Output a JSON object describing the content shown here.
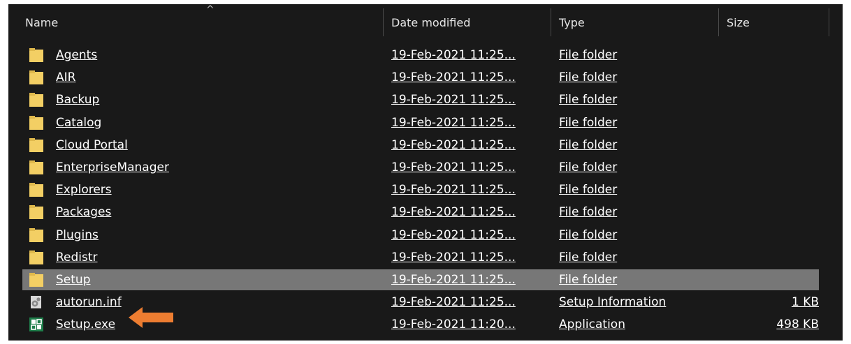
{
  "columns": {
    "name": "Name",
    "date": "Date modified",
    "type": "Type",
    "size": "Size"
  },
  "files": [
    {
      "name": "Agents",
      "date": "19-Feb-2021 11:25...",
      "type": "File folder",
      "size": "",
      "icon": "folder-icon"
    },
    {
      "name": "AIR",
      "date": "19-Feb-2021 11:25...",
      "type": "File folder",
      "size": "",
      "icon": "folder-icon"
    },
    {
      "name": "Backup",
      "date": "19-Feb-2021 11:25...",
      "type": "File folder",
      "size": "",
      "icon": "folder-icon"
    },
    {
      "name": "Catalog",
      "date": "19-Feb-2021 11:25...",
      "type": "File folder",
      "size": "",
      "icon": "folder-icon"
    },
    {
      "name": "Cloud Portal",
      "date": "19-Feb-2021 11:25...",
      "type": "File folder",
      "size": "",
      "icon": "folder-icon"
    },
    {
      "name": "EnterpriseManager",
      "date": "19-Feb-2021 11:25...",
      "type": "File folder",
      "size": "",
      "icon": "folder-icon"
    },
    {
      "name": "Explorers",
      "date": "19-Feb-2021 11:25...",
      "type": "File folder",
      "size": "",
      "icon": "folder-icon"
    },
    {
      "name": "Packages",
      "date": "19-Feb-2021 11:25...",
      "type": "File folder",
      "size": "",
      "icon": "folder-icon"
    },
    {
      "name": "Plugins",
      "date": "19-Feb-2021 11:25...",
      "type": "File folder",
      "size": "",
      "icon": "folder-icon"
    },
    {
      "name": "Redistr",
      "date": "19-Feb-2021 11:25...",
      "type": "File folder",
      "size": "",
      "icon": "folder-icon"
    },
    {
      "name": "Setup",
      "date": "19-Feb-2021 11:25...",
      "type": "File folder",
      "size": "",
      "icon": "folder-icon",
      "selected": true
    },
    {
      "name": "autorun.inf",
      "date": "19-Feb-2021 11:25...",
      "type": "Setup Information",
      "size": "1 KB",
      "icon": "settings-file-icon"
    },
    {
      "name": "Setup.exe",
      "date": "19-Feb-2021 11:20...",
      "type": "Application",
      "size": "498 KB",
      "icon": "application-icon"
    }
  ],
  "annotation": {
    "icon": "orange-arrow-icon",
    "color": "#ed7d31"
  },
  "colors": {
    "background": "#191919",
    "folder": "#f3cf64",
    "selected_row": "#777777",
    "text": "#ffffff"
  }
}
